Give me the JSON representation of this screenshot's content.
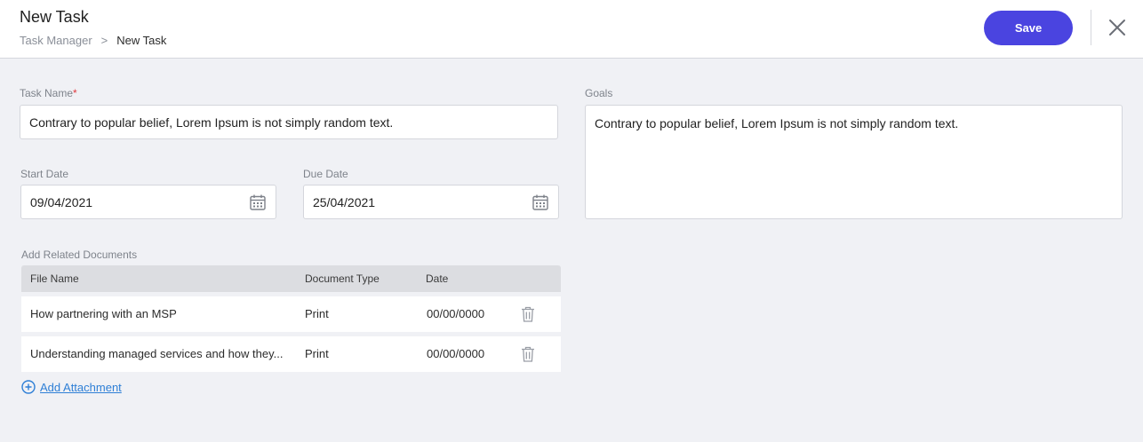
{
  "header": {
    "title": "New Task",
    "breadcrumb": {
      "parent": "Task Manager",
      "separator": ">",
      "current": "New Task"
    },
    "save_label": "Save",
    "close_icon": "close-icon"
  },
  "form": {
    "task_name": {
      "label": "Task Name",
      "required_mark": "*",
      "value": "Contrary to popular belief, Lorem Ipsum is not simply random text."
    },
    "start_date": {
      "label": "Start Date",
      "value": "09/04/2021"
    },
    "due_date": {
      "label": "Due Date",
      "value": "25/04/2021"
    },
    "goals": {
      "label": "Goals",
      "value": "Contrary to popular belief, Lorem Ipsum is not simply random text."
    }
  },
  "documents": {
    "label": "Add Related Documents",
    "columns": [
      "File Name",
      "Document Type",
      "Date"
    ],
    "rows": [
      {
        "file_name": "How partnering with an MSP",
        "type": "Print",
        "date": "00/00/0000"
      },
      {
        "file_name": "Understanding managed services and how they...",
        "type": "Print",
        "date": "00/00/0000"
      }
    ],
    "add_label": "Add Attachment"
  },
  "colors": {
    "accent": "#4a44e0",
    "link": "#2e7fd6",
    "required": "#e0393e"
  }
}
